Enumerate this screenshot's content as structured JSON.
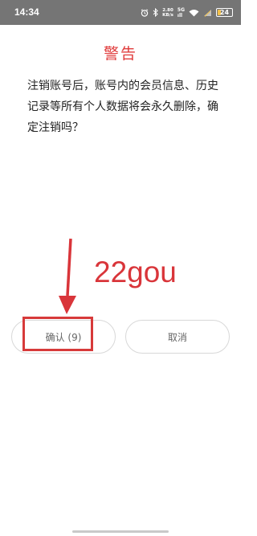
{
  "status_bar": {
    "time": "14:34",
    "speed_value": "2.80",
    "speed_unit": "KB/s",
    "network_top": "5G",
    "network_bottom": "ıll",
    "battery_level": "24",
    "battery_fraction": 0.24
  },
  "dialog": {
    "title": "警告",
    "message": "注销账号后，账号内的会员信息、历史记录等所有个人数据将会永久删除，确定注销吗？",
    "confirm_label": "确认 (9)",
    "cancel_label": "取消"
  },
  "annotation": {
    "text": "22gou",
    "color": "#d9353a"
  },
  "colors": {
    "title": "#e03b3b",
    "status_bar": "#757575"
  }
}
